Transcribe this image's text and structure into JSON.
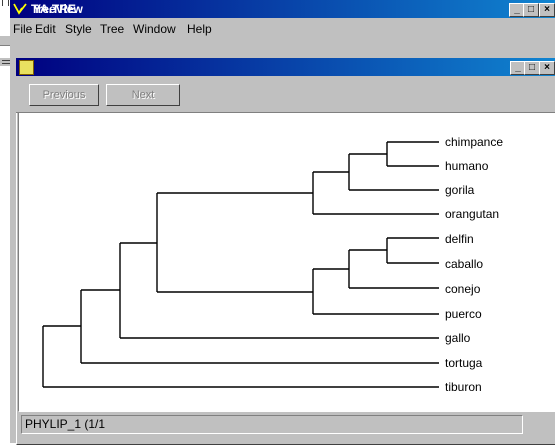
{
  "app": {
    "title": "TreeView",
    "menu": [
      "File",
      "Edit",
      "Style",
      "Tree",
      "Window",
      "Help"
    ],
    "window_controls": [
      "minimize",
      "maximize",
      "close"
    ]
  },
  "document": {
    "title": "YA.TRE",
    "toolbar": {
      "previous": "Previous",
      "next": "Next"
    },
    "status": "PHYLIP_1  (1/1"
  },
  "tree": {
    "leaves": [
      "chimpance",
      "humano",
      "gorila",
      "orangutan",
      "delfin",
      "caballo",
      "conejo",
      "puerco",
      "gallo",
      "tortuga",
      "tiburon"
    ]
  },
  "icons": {
    "app_logo": "treeview-logo-icon",
    "doc_icon": "tree-document-icon",
    "minimize": "minimize-icon",
    "maximize": "maximize-icon",
    "close": "close-icon"
  },
  "colors": {
    "title_bar": "#000080",
    "title_bar_gradient_end": "#1084d0",
    "chrome": "#c0c0c0"
  }
}
